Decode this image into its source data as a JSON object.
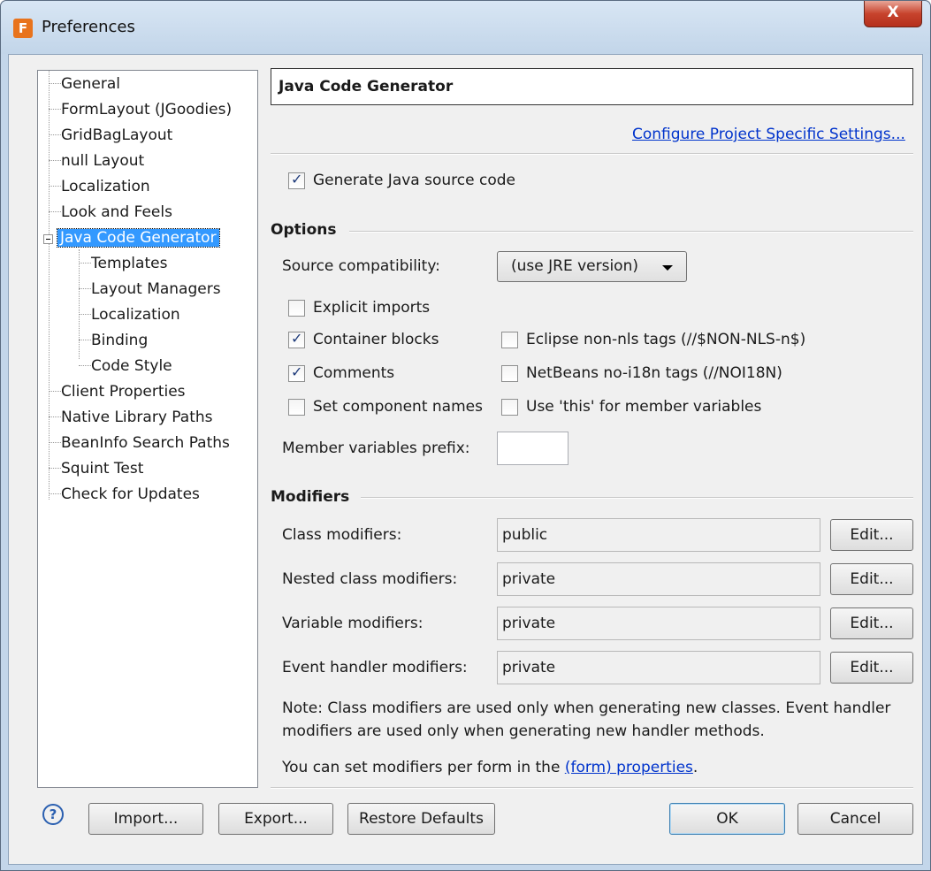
{
  "window": {
    "title": "Preferences",
    "app_icon": "jformdesigner-icon",
    "close_glyph": "X"
  },
  "tree": {
    "items": [
      "General",
      "FormLayout (JGoodies)",
      "GridBagLayout",
      "null Layout",
      "Localization",
      "Look and Feels",
      "Java Code Generator",
      "Templates",
      "Layout Managers",
      "Localization",
      "Binding",
      "Code Style",
      "Client Properties",
      "Native Library Paths",
      "BeanInfo Search Paths",
      "Squint Test",
      "Check for Updates"
    ],
    "selected": "Java Code Generator"
  },
  "page": {
    "title": "Java Code Generator",
    "configure_link": "Configure Project Specific Settings...",
    "generate_checkbox": {
      "label": "Generate Java source code",
      "checked": true
    }
  },
  "options": {
    "section_title": "Options",
    "source_compat_label": "Source compatibility:",
    "source_compat_value": "(use JRE version)",
    "checkboxes": {
      "explicit_imports": {
        "label": "Explicit imports",
        "checked": false
      },
      "container_blocks": {
        "label": "Container blocks",
        "checked": true
      },
      "comments": {
        "label": "Comments",
        "checked": true
      },
      "set_component_names": {
        "label": "Set component names",
        "checked": false
      },
      "eclipse_nonnls": {
        "label": "Eclipse non-nls tags (//$NON-NLS-n$)",
        "checked": false
      },
      "netbeans_noi18n": {
        "label": "NetBeans no-i18n tags (//NOI18N)",
        "checked": false
      },
      "use_this": {
        "label": "Use 'this' for member variables",
        "checked": false
      }
    },
    "member_prefix_label": "Member variables prefix:",
    "member_prefix_value": ""
  },
  "modifiers": {
    "section_title": "Modifiers",
    "rows": [
      {
        "label": "Class modifiers:",
        "value": "public",
        "button": "Edit..."
      },
      {
        "label": "Nested class modifiers:",
        "value": "private",
        "button": "Edit..."
      },
      {
        "label": "Variable modifiers:",
        "value": "private",
        "button": "Edit..."
      },
      {
        "label": "Event handler modifiers:",
        "value": "private",
        "button": "Edit..."
      }
    ],
    "note_line1": "Note: Class modifiers are used only when generating new classes. Event handler",
    "note_line2": "modifiers are used only when generating new handler methods.",
    "form_note_prefix": "You can set modifiers per form in the",
    "form_note_link": "(form) properties",
    "form_note_suffix": "."
  },
  "footer": {
    "help_glyph": "?",
    "import": "Import...",
    "export": "Export...",
    "restore": "Restore Defaults",
    "ok": "OK",
    "cancel": "Cancel"
  }
}
